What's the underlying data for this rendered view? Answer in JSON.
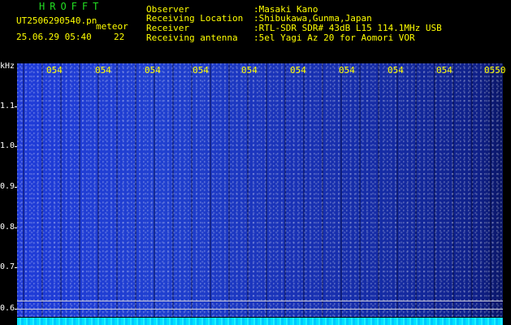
{
  "colors": {
    "title": "#22dd22",
    "text_yellow": "#ffff00",
    "axis_white": "#ffffff",
    "spectrum_blue": "#1f3bd8",
    "baseband_cyan": "#00e0ff"
  },
  "header": {
    "app_title": "HROFFT",
    "filename": "UT2506290540.pn",
    "mode": "meteor",
    "datetime": "25.06.29 05:40",
    "count": "22",
    "fields": [
      {
        "label": "Observer",
        "value": ":Masaki Kano"
      },
      {
        "label": "Receiving Location",
        "value": ":Shibukawa,Gunma,Japan"
      },
      {
        "label": "Receiver",
        "value": ":RTL-SDR SDR# 43dB L15 114.1MHz USB"
      },
      {
        "label": "Receiving antenna",
        "value": ":5el Yagi Az 20 for Aomori VOR"
      }
    ]
  },
  "axis": {
    "y_unit": "kHz",
    "y_ticks": [
      "1.1",
      "1.0",
      "0.9",
      "0.8",
      "0.7",
      "0.6"
    ],
    "x_ticks": [
      "054",
      "054",
      "054",
      "054",
      "054",
      "054",
      "054",
      "054",
      "054",
      "0550"
    ]
  }
}
